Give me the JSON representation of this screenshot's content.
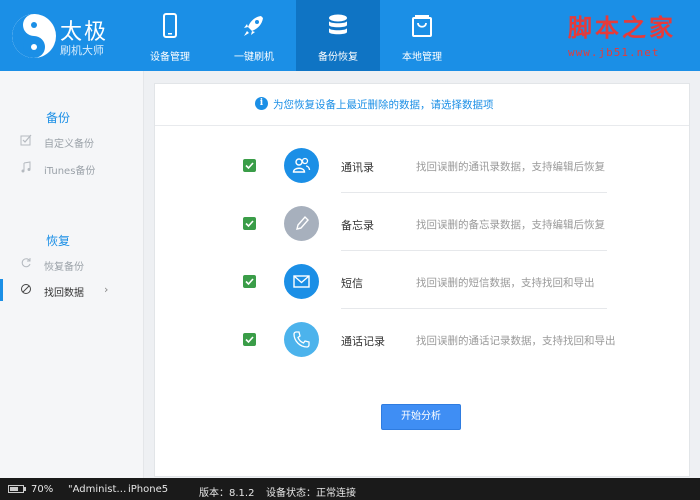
{
  "app": {
    "name": "太极",
    "subtitle": "刷机大师"
  },
  "nav": [
    {
      "label": "设备管理",
      "icon": "phone-icon"
    },
    {
      "label": "一键刷机",
      "icon": "rocket-icon"
    },
    {
      "label": "备份恢复",
      "icon": "database-icon"
    },
    {
      "label": "本地管理",
      "icon": "bag-icon"
    }
  ],
  "watermark": {
    "text": "脚本之家",
    "url": "www.jb51.net"
  },
  "sidebar": {
    "backup_heading": "备份",
    "backup_items": [
      {
        "label": "自定义备份",
        "icon": "checkbox-icon"
      },
      {
        "label": "iTunes备份",
        "icon": "music-note-icon"
      }
    ],
    "restore_heading": "恢复",
    "restore_items": [
      {
        "label": "恢复备份",
        "icon": "restore-icon"
      },
      {
        "label": "找回数据",
        "icon": "search-icon"
      }
    ],
    "chevron": "›"
  },
  "main": {
    "notice": "为您恢复设备上最近删除的数据，请选择数据项",
    "items": [
      {
        "title": "通讯录",
        "desc": "找回误删的通讯录数据，支持编辑后恢复",
        "checked": true,
        "icon": "contacts-icon",
        "color": "#1b8fe6"
      },
      {
        "title": "备忘录",
        "desc": "找回误删的备忘录数据，支持编辑后恢复",
        "checked": true,
        "icon": "pencil-icon",
        "color": "#a7b0bd"
      },
      {
        "title": "短信",
        "desc": "找回误删的短信数据，支持找回和导出",
        "checked": true,
        "icon": "envelope-icon",
        "color": "#1b8fe6"
      },
      {
        "title": "通话记录",
        "desc": "找回误删的通话记录数据，支持找回和导出",
        "checked": true,
        "icon": "phone-call-icon",
        "color": "#4cb3ec"
      }
    ],
    "start_button": "开始分析"
  },
  "status": {
    "battery": "70%",
    "battery_level": 0.7,
    "device_name": "\"Administ…",
    "device_model": "iPhone5",
    "version": "版本：8.1.2",
    "device_status": "设备状态：正常连接"
  },
  "colors": {
    "brand": "#1b8fe6",
    "check": "#3a9d48",
    "button": "#3f8ef4"
  }
}
